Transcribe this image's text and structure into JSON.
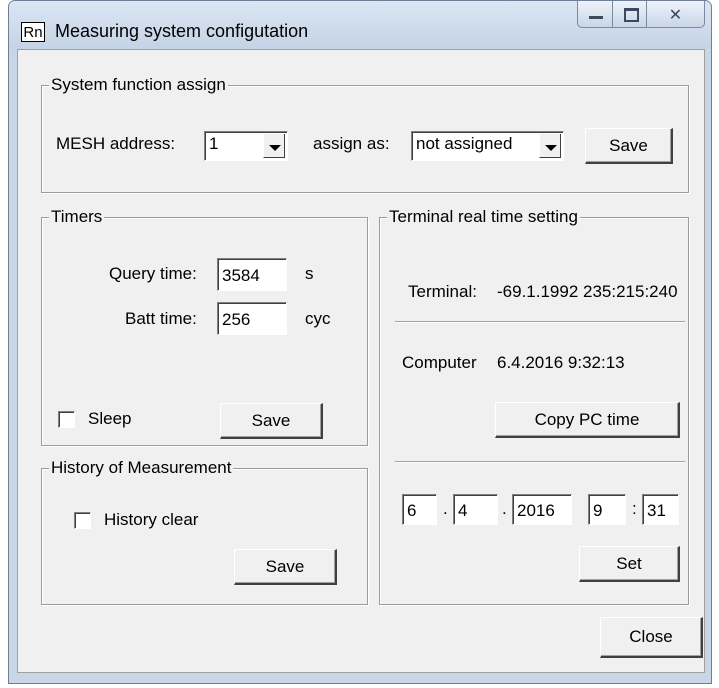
{
  "window": {
    "icon_text": "Rn",
    "title": "Measuring system configutation"
  },
  "system_function": {
    "title": "System function assign",
    "mesh_label": "MESH address:",
    "mesh_value": "1",
    "assign_label": "assign as:",
    "assign_value": "not assigned",
    "save_label": "Save"
  },
  "timers": {
    "title": "Timers",
    "query_label": "Query time:",
    "query_value": "3584",
    "query_unit": "s",
    "batt_label": "Batt time:",
    "batt_value": "256",
    "batt_unit": "cyc",
    "sleep_label": "Sleep",
    "sleep_checked": false,
    "save_label": "Save"
  },
  "history": {
    "title": "History of Measurement",
    "clear_label": "History clear",
    "clear_checked": false,
    "save_label": "Save"
  },
  "terminal_rtc": {
    "title": "Terminal real time setting",
    "terminal_label": "Terminal:",
    "terminal_value": "-69.1.1992 235:215:240",
    "computer_label": "Computer",
    "computer_value": "6.4.2016 9:32:13",
    "copy_label": "Copy PC time",
    "day": "6",
    "month": "4",
    "year": "2016",
    "hour": "9",
    "minute": "31",
    "dot1": ".",
    "dot2": ".",
    "colon": ":",
    "set_label": "Set"
  },
  "footer": {
    "close_label": "Close"
  }
}
